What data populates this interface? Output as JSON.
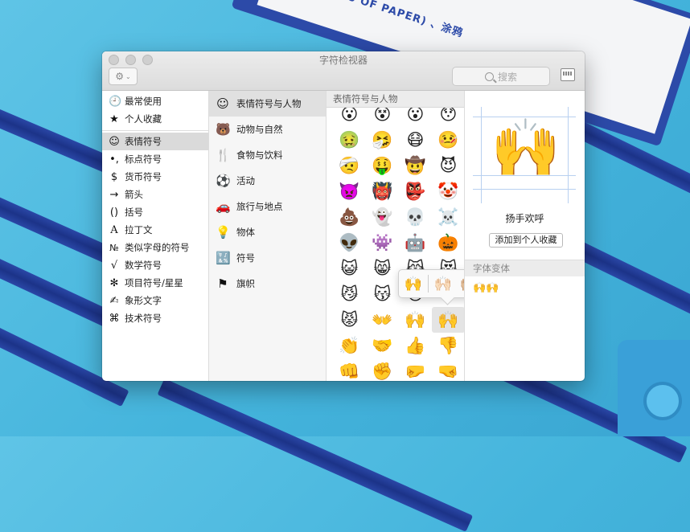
{
  "desktop": {
    "book_text": "S OF PAPER)  、涂鸦"
  },
  "window": {
    "title": "字符检视器",
    "search_placeholder": "搜索"
  },
  "categories": [
    {
      "icon": "🕘",
      "label": "最常使用"
    },
    {
      "icon": "★",
      "label": "个人收藏"
    },
    {
      "icon": "☺",
      "label": "表情符号"
    },
    {
      "icon": "•,",
      "label": "标点符号"
    },
    {
      "icon": "$",
      "label": "货币符号"
    },
    {
      "icon": "→",
      "label": "箭头"
    },
    {
      "icon": "()",
      "label": "括号"
    },
    {
      "icon": "A",
      "label": "拉丁文"
    },
    {
      "icon": "№",
      "label": "类似字母的符号"
    },
    {
      "icon": "√",
      "label": "数学符号"
    },
    {
      "icon": "✻",
      "label": "项目符号/星星"
    },
    {
      "icon": "✍",
      "label": "象形文字"
    },
    {
      "icon": "⌘",
      "label": "技术符号"
    }
  ],
  "subcategories": [
    {
      "icon": "☺",
      "label": "表情符号与人物"
    },
    {
      "icon": "🐻",
      "label": "动物与自然"
    },
    {
      "icon": "🍴",
      "label": "食物与饮料"
    },
    {
      "icon": "⚽",
      "label": "活动"
    },
    {
      "icon": "🚗",
      "label": "旅行与地点"
    },
    {
      "icon": "💡",
      "label": "物体"
    },
    {
      "icon": "🔣",
      "label": "符号"
    },
    {
      "icon": "⚑",
      "label": "旗帜"
    }
  ],
  "section_header": "表情符号与人物",
  "emoji_grid": [
    "😮",
    "😵",
    "😮",
    "😯",
    "🤢",
    "🤧",
    "😷",
    "🤒",
    "🤕",
    "🤑",
    "🤠",
    "😈",
    "👿",
    "👹",
    "👺",
    "🤡",
    "💩",
    "👻",
    "💀",
    "☠️",
    "👽",
    "👾",
    "🤖",
    "🎃",
    "😺",
    "😸",
    "😹",
    "😻",
    "😼",
    "😽",
    "🙀",
    "😿",
    "😾",
    "👐",
    "🙌",
    "🙌",
    "👏",
    "🤝",
    "👍",
    "👎",
    "👊",
    "✊",
    "🤛",
    "🤜"
  ],
  "skin_variants": [
    "🙌",
    "🙌🏻",
    "🙌🏼",
    "🙌🏽",
    "🙌🏾",
    "🙌🏿"
  ],
  "preview": {
    "glyph": "🙌",
    "name": "扬手欢呼",
    "add_favorite_label": "添加到个人收藏",
    "variants_header": "字体变体",
    "variants_mini": "🙌🙌"
  }
}
